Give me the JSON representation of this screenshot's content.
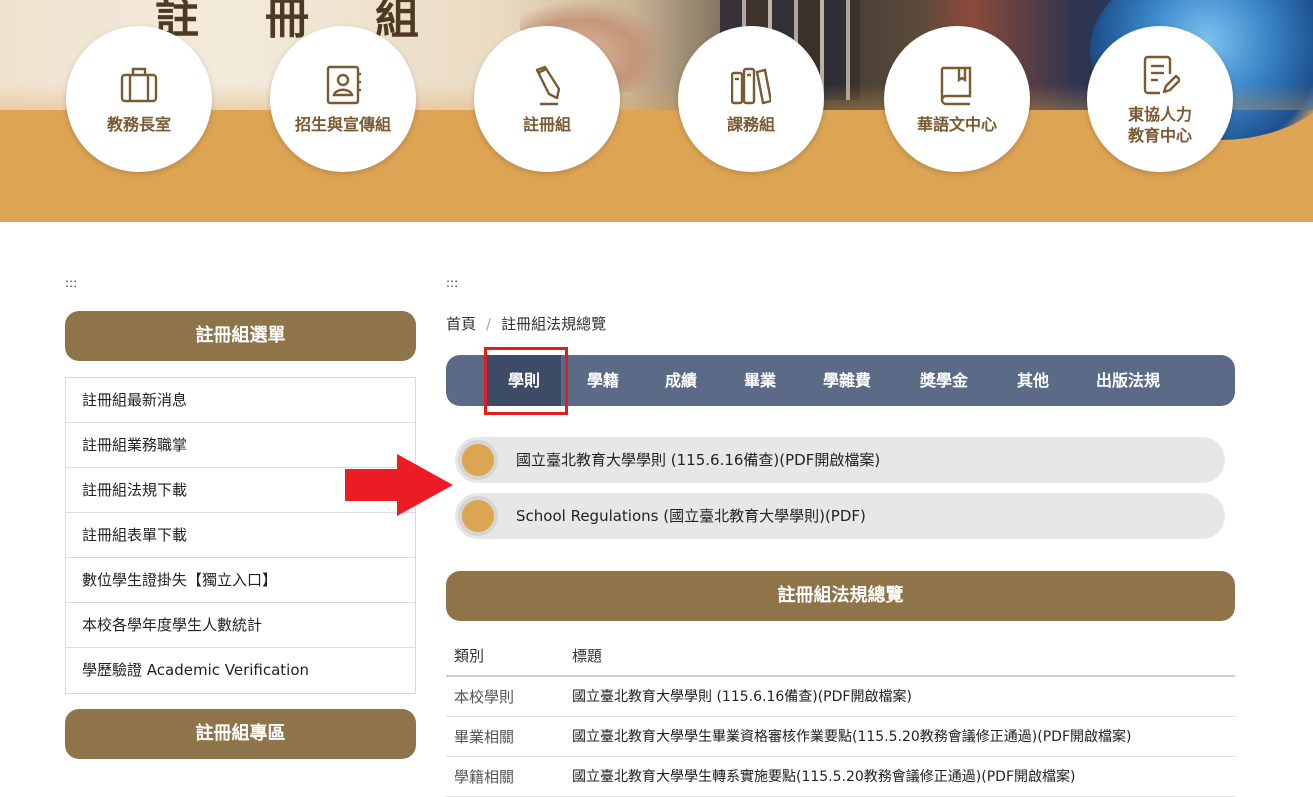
{
  "banner": {
    "title_chars": [
      "註",
      "冊",
      "組"
    ],
    "nav": [
      {
        "label": "教務長室",
        "icon": "briefcase-icon"
      },
      {
        "label": "招生與宣傳組",
        "icon": "contact-book-icon"
      },
      {
        "label": "註冊組",
        "icon": "pencil-icon"
      },
      {
        "label": "課務組",
        "icon": "books-icon"
      },
      {
        "label": "華語文中心",
        "icon": "book-icon"
      },
      {
        "label_line1": "東協人力",
        "label_line2": "教育中心",
        "icon": "document-edit-icon"
      }
    ]
  },
  "skip_marker": ":::",
  "sidebar": {
    "menu_title": "註冊組選單",
    "items": [
      "註冊組最新消息",
      "註冊組業務職掌",
      "註冊組法規下載",
      "註冊組表單下載",
      "數位學生證掛失【獨立入口】",
      "本校各學年度學生人數統計",
      "學歷驗證 Academic Verification"
    ],
    "zone_title": "註冊組專區"
  },
  "breadcrumb": {
    "home": "首頁",
    "separator": "/",
    "current": "註冊組法規總覽"
  },
  "tabs": [
    "學則",
    "學籍",
    "成績",
    "畢業",
    "學雜費",
    "獎學金",
    "其他",
    "出版法規"
  ],
  "active_tab": "學則",
  "documents": [
    "國立臺北教育大學學則 (115.6.16備查)(PDF開啟檔案)",
    "School Regulations (國立臺北教育大學學則)(PDF)"
  ],
  "overview": {
    "title": "註冊組法規總覽",
    "columns": [
      "類別",
      "標題"
    ],
    "rows": [
      {
        "category": "本校學則",
        "title": "國立臺北教育大學學則 (115.6.16備查)(PDF開啟檔案)"
      },
      {
        "category": "畢業相關",
        "title": "國立臺北教育大學學生畢業資格審核作業要點(115.5.20教務會議修正通過)(PDF開啟檔案)"
      },
      {
        "category": "學籍相關",
        "title": "國立臺北教育大學學生轉系實施要點(115.5.20教務會議修正通過)(PDF開啟檔案)"
      }
    ]
  },
  "colors": {
    "brand_brown": "#8e7448",
    "banner_gold": "#dda453",
    "tab_bar": "#5a6a87",
    "tab_active": "#3e4b67",
    "highlight_red": "#e01e1e",
    "doc_dot": "#dca552"
  }
}
